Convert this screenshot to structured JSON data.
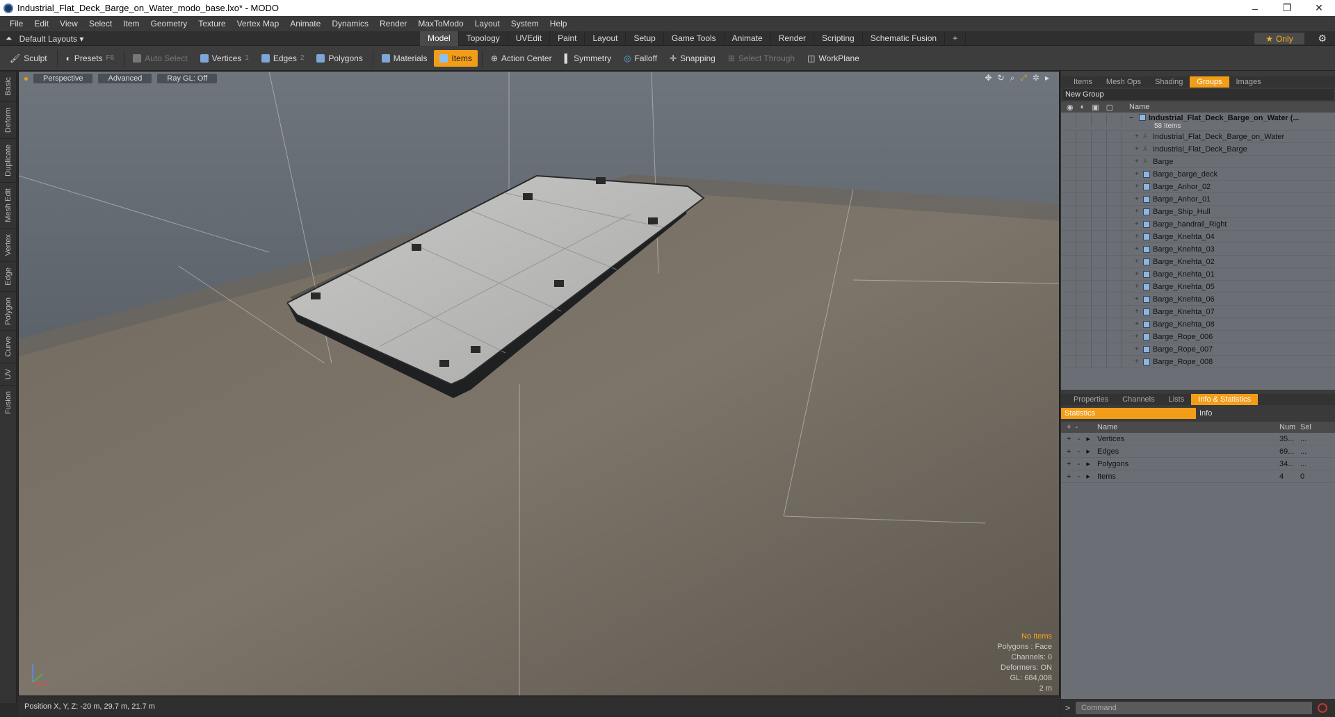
{
  "window": {
    "title": "Industrial_Flat_Deck_Barge_on_Water_modo_base.lxo* - MODO",
    "minimize": "–",
    "restore": "❐",
    "close": "✕"
  },
  "menu": [
    "File",
    "Edit",
    "View",
    "Select",
    "Item",
    "Geometry",
    "Texture",
    "Vertex Map",
    "Animate",
    "Dynamics",
    "Render",
    "MaxToModo",
    "Layout",
    "System",
    "Help"
  ],
  "layouts": {
    "label": "Default Layouts ▾"
  },
  "mode_tabs": [
    {
      "label": "Model",
      "active": true
    },
    {
      "label": "Topology"
    },
    {
      "label": "UVEdit"
    },
    {
      "label": "Paint"
    },
    {
      "label": "Layout"
    },
    {
      "label": "Setup"
    },
    {
      "label": "Game Tools"
    },
    {
      "label": "Animate"
    },
    {
      "label": "Render"
    },
    {
      "label": "Scripting"
    },
    {
      "label": "Schematic Fusion"
    }
  ],
  "add_tab": "+",
  "only_label": "Only",
  "toolbar": {
    "sculpt": "Sculpt",
    "presets": "Presets",
    "presets_key": "F6",
    "auto_select": "Auto Select",
    "vertices": "Vertices",
    "vertices_key": "1",
    "edges": "Edges",
    "edges_key": "2",
    "polygons": "Polygons",
    "materials": "Materials",
    "items": "Items",
    "action_center": "Action Center",
    "symmetry": "Symmetry",
    "falloff": "Falloff",
    "snapping": "Snapping",
    "select_through": "Select Through",
    "workplane": "WorkPlane"
  },
  "left_tabs": [
    "Basic",
    "Deform",
    "Duplicate",
    "Mesh Edit",
    "Vertex",
    "Edge",
    "Polygon",
    "Curve",
    "UV",
    "Fusion"
  ],
  "viewport": {
    "view": "Perspective",
    "shading": "Advanced",
    "raygl": "Ray GL: Off",
    "info": {
      "no_items": "No Items",
      "polygons": "Polygons : Face",
      "channels": "Channels: 0",
      "deformers": "Deformers: ON",
      "gl": "GL: 684,008",
      "scale": "2 m"
    }
  },
  "status_bar": {
    "position": "Position X, Y, Z:  -20 m, 29.7 m, 21.7 m"
  },
  "top_panel": {
    "tabs": [
      {
        "label": "Items"
      },
      {
        "label": "Mesh Ops"
      },
      {
        "label": "Shading"
      },
      {
        "label": "Groups",
        "active": true
      },
      {
        "label": "Images"
      }
    ],
    "new_group": "New Group",
    "name_header": "Name",
    "group": {
      "name": "Industrial_Flat_Deck_Barge_on_Water",
      "suffix": "(...",
      "count": "58 Items"
    },
    "items": [
      {
        "label": "Industrial_Flat_Deck_Barge_on_Water",
        "kind": "locator"
      },
      {
        "label": "Industrial_Flat_Deck_Barge",
        "kind": "locator"
      },
      {
        "label": "Barge",
        "kind": "locator"
      },
      {
        "label": "Barge_barge_deck",
        "kind": "mesh"
      },
      {
        "label": "Barge_Anhor_02",
        "kind": "mesh"
      },
      {
        "label": "Barge_Anhor_01",
        "kind": "mesh"
      },
      {
        "label": "Barge_Ship_Hull",
        "kind": "mesh"
      },
      {
        "label": "Barge_handrail_Right",
        "kind": "mesh"
      },
      {
        "label": "Barge_Knehta_04",
        "kind": "mesh"
      },
      {
        "label": "Barge_Knehta_03",
        "kind": "mesh"
      },
      {
        "label": "Barge_Knehta_02",
        "kind": "mesh"
      },
      {
        "label": "Barge_Knehta_01",
        "kind": "mesh"
      },
      {
        "label": "Barge_Knehta_05",
        "kind": "mesh"
      },
      {
        "label": "Barge_Knehta_06",
        "kind": "mesh"
      },
      {
        "label": "Barge_Knehta_07",
        "kind": "mesh"
      },
      {
        "label": "Barge_Knehta_08",
        "kind": "mesh"
      },
      {
        "label": "Barge_Rope_006",
        "kind": "mesh"
      },
      {
        "label": "Barge_Rope_007",
        "kind": "mesh"
      },
      {
        "label": "Barge_Rope_008",
        "kind": "mesh"
      }
    ]
  },
  "bottom_panel": {
    "tabs": [
      {
        "label": "Properties"
      },
      {
        "label": "Channels"
      },
      {
        "label": "Lists"
      },
      {
        "label": "Info & Statistics",
        "active": true
      }
    ],
    "statistics_tab": "Statistics",
    "info_tab": "Info",
    "headers": {
      "name": "Name",
      "num": "Num",
      "sel": "Sel"
    },
    "rows": [
      {
        "name": "Vertices",
        "num": "35...",
        "sel": "..."
      },
      {
        "name": "Edges",
        "num": "69...",
        "sel": "..."
      },
      {
        "name": "Polygons",
        "num": "34...",
        "sel": "..."
      },
      {
        "name": "Items",
        "num": "4",
        "sel": "0"
      }
    ]
  },
  "command": {
    "prompt": ">",
    "placeholder": "Command"
  },
  "colors": {
    "accent": "#f29d18",
    "viewport_bg": "#5a6168",
    "panel_bg": "#3a3a3a"
  }
}
